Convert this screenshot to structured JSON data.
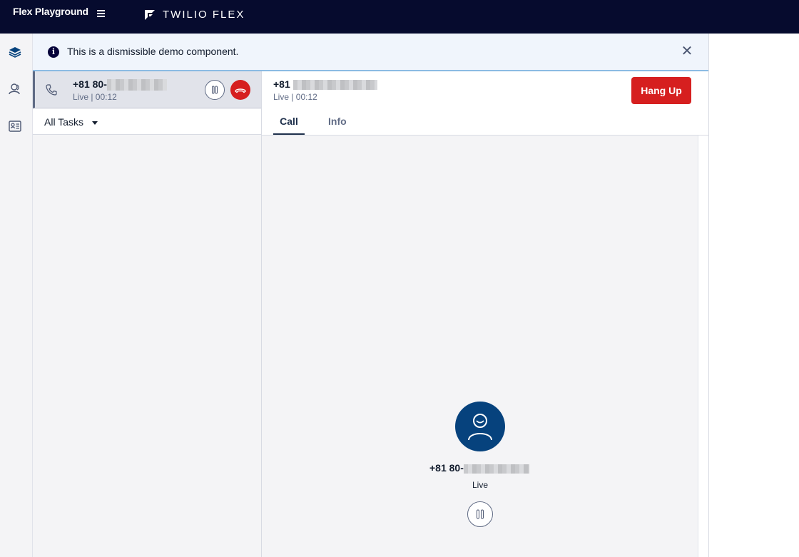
{
  "topbar": {
    "app_title": "Flex Playground",
    "brand": "TWILIO FLEX",
    "menu_icon": "hamburger-icon",
    "logo_icon": "twilio-flex-logo"
  },
  "rail": {
    "items": [
      {
        "icon": "layers-icon"
      },
      {
        "icon": "agents-icon"
      },
      {
        "icon": "directory-card-icon"
      }
    ]
  },
  "banner": {
    "text": "This is a dismissible demo component.",
    "info_icon": "i",
    "close_glyph": "✕"
  },
  "task_list": {
    "task": {
      "number_prefix": "+81 80-",
      "status": "Live | 00:12"
    },
    "filter_label": "All Tasks"
  },
  "detail": {
    "number_prefix": "+81",
    "status": "Live | 00:12",
    "hangup_label": "Hang Up",
    "tabs": [
      {
        "label": "Call",
        "active": true
      },
      {
        "label": "Info",
        "active": false
      }
    ],
    "canvas": {
      "number_prefix": "+81 80-",
      "status": "Live"
    }
  },
  "colors": {
    "topbar": "#060b2e",
    "danger": "#d61f1f",
    "avatar": "#06427d",
    "banner_bg": "#f0f5fc"
  }
}
